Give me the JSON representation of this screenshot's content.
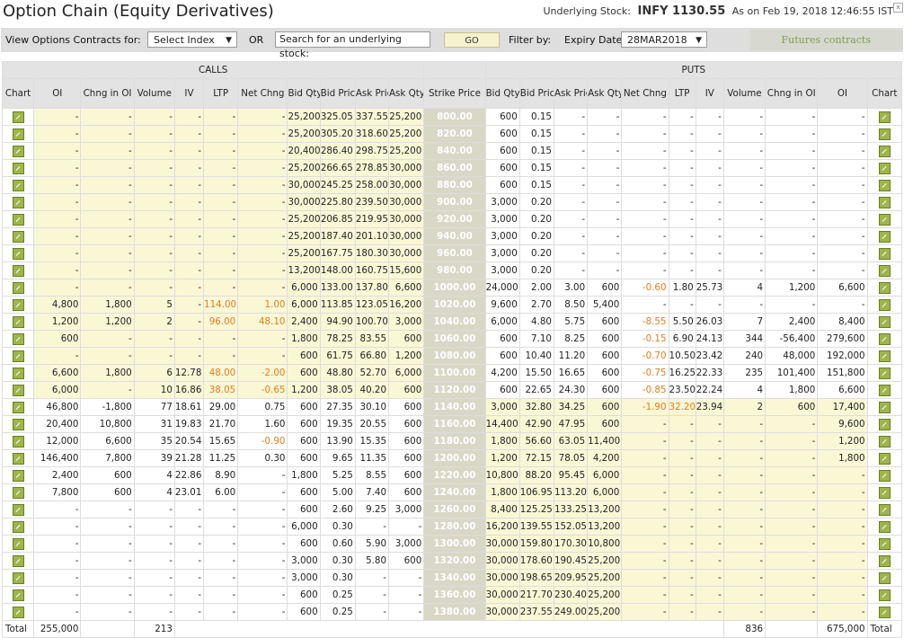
{
  "header": {
    "title": "Option Chain (Equity Derivatives)",
    "underlying_label": "Underlying Stock:",
    "underlying_value": "INFY 1130.55",
    "as_on": "As on Feb 19, 2018 12:46:55 IST",
    "close_glyph": "x"
  },
  "toolbar": {
    "view_label": "View Options Contracts for:",
    "index_select": "Select Index",
    "or_label": "OR",
    "search_value": "Search for an underlying stock:",
    "go_label": "GO",
    "filter_label": "Filter by:",
    "expiry_label": "Expiry Date",
    "expiry_value": "28MAR2018",
    "futures_link": "Futures contracts"
  },
  "table": {
    "calls_label": "CALLS",
    "puts_label": "PUTS",
    "headers": [
      "Chart",
      "OI",
      "Chng in OI",
      "Volume",
      "IV",
      "LTP",
      "Net Chng",
      "Bid Qty",
      "Bid Price",
      "Ask Price",
      "Ask Qty",
      "Strike Price",
      "Bid Qty",
      "Bid Price",
      "Ask Price",
      "Ask Qty",
      "Net Chng",
      "LTP",
      "IV",
      "Volume",
      "Chng in OI",
      "OI",
      "Chart"
    ],
    "rows": [
      [
        "",
        "-",
        "-",
        "-",
        "-",
        "-",
        "-",
        "25,200",
        "325.05",
        "337.55",
        "25,200",
        "800.00",
        "600",
        "0.15",
        "-",
        "-",
        "-",
        "-",
        "-",
        "-",
        "-",
        "-",
        ""
      ],
      [
        "",
        "-",
        "-",
        "-",
        "-",
        "-",
        "-",
        "25,200",
        "305.20",
        "318.60",
        "25,200",
        "820.00",
        "600",
        "0.15",
        "-",
        "-",
        "-",
        "-",
        "-",
        "-",
        "-",
        "-",
        ""
      ],
      [
        "",
        "-",
        "-",
        "-",
        "-",
        "-",
        "-",
        "20,400",
        "286.40",
        "298.75",
        "25,200",
        "840.00",
        "600",
        "0.15",
        "-",
        "-",
        "-",
        "-",
        "-",
        "-",
        "-",
        "-",
        ""
      ],
      [
        "",
        "-",
        "-",
        "-",
        "-",
        "-",
        "-",
        "25,200",
        "266.65",
        "278.85",
        "30,000",
        "860.00",
        "600",
        "0.15",
        "-",
        "-",
        "-",
        "-",
        "-",
        "-",
        "-",
        "-",
        ""
      ],
      [
        "",
        "-",
        "-",
        "-",
        "-",
        "-",
        "-",
        "30,000",
        "245.25",
        "258.00",
        "30,000",
        "880.00",
        "600",
        "0.15",
        "-",
        "-",
        "-",
        "-",
        "-",
        "-",
        "-",
        "-",
        ""
      ],
      [
        "",
        "-",
        "-",
        "-",
        "-",
        "-",
        "-",
        "30,000",
        "225.80",
        "239.50",
        "30,000",
        "900.00",
        "3,000",
        "0.20",
        "-",
        "-",
        "-",
        "-",
        "-",
        "-",
        "-",
        "-",
        ""
      ],
      [
        "",
        "-",
        "-",
        "-",
        "-",
        "-",
        "-",
        "25,200",
        "206.85",
        "219.95",
        "30,000",
        "920.00",
        "3,000",
        "0.20",
        "-",
        "-",
        "-",
        "-",
        "-",
        "-",
        "-",
        "-",
        ""
      ],
      [
        "",
        "-",
        "-",
        "-",
        "-",
        "-",
        "-",
        "25,200",
        "187.40",
        "201.10",
        "30,000",
        "940.00",
        "3,000",
        "0.20",
        "-",
        "-",
        "-",
        "-",
        "-",
        "-",
        "-",
        "-",
        ""
      ],
      [
        "",
        "-",
        "-",
        "-",
        "-",
        "-",
        "-",
        "25,200",
        "167.75",
        "180.30",
        "30,000",
        "960.00",
        "3,000",
        "0.20",
        "-",
        "-",
        "-",
        "-",
        "-",
        "-",
        "-",
        "-",
        ""
      ],
      [
        "",
        "-",
        "-",
        "-",
        "-",
        "-",
        "-",
        "13,200",
        "148.00",
        "160.75",
        "15,600",
        "980.00",
        "3,000",
        "0.20",
        "-",
        "-",
        "-",
        "-",
        "-",
        "-",
        "-",
        "-",
        ""
      ],
      [
        "",
        "-",
        "-",
        "-",
        "-",
        "-",
        "-",
        "6,000",
        "133.00",
        "137.80",
        "6,600",
        "1000.00",
        "24,000",
        "2.00",
        "3.00",
        "600",
        "-0.60",
        "1.80",
        "25.73",
        "4",
        "1,200",
        "6,600",
        ""
      ],
      [
        "",
        "4,800",
        "1,800",
        "5",
        "-",
        "114.00",
        "1.00",
        "6,000",
        "113.85",
        "123.05",
        "16,200",
        "1020.00",
        "9,600",
        "2.70",
        "8.50",
        "5,400",
        "-",
        "-",
        "-",
        "-",
        "-",
        "-",
        ""
      ],
      [
        "",
        "1,200",
        "1,200",
        "2",
        "-",
        "96.00",
        "48.10",
        "2,400",
        "94.90",
        "100.70",
        "3,000",
        "1040.00",
        "6,000",
        "4.80",
        "5.75",
        "600",
        "-8.55",
        "5.50",
        "26.03",
        "7",
        "2,400",
        "8,400",
        ""
      ],
      [
        "",
        "600",
        "-",
        "-",
        "-",
        "-",
        "-",
        "1,800",
        "78.25",
        "83.55",
        "600",
        "1060.00",
        "600",
        "7.10",
        "8.25",
        "600",
        "-0.15",
        "6.90",
        "24.13",
        "344",
        "-56,400",
        "279,600",
        ""
      ],
      [
        "",
        "-",
        "-",
        "-",
        "-",
        "-",
        "-",
        "600",
        "61.75",
        "66.80",
        "1,200",
        "1080.00",
        "600",
        "10.40",
        "11.20",
        "600",
        "-0.70",
        "10.50",
        "23.42",
        "240",
        "48,000",
        "192,000",
        ""
      ],
      [
        "",
        "6,600",
        "1,800",
        "6",
        "12.78",
        "48.00",
        "-2.00",
        "600",
        "48.80",
        "52.70",
        "6,000",
        "1100.00",
        "4,200",
        "15.50",
        "16.65",
        "600",
        "-0.75",
        "16.25",
        "22.33",
        "235",
        "101,400",
        "151,800",
        ""
      ],
      [
        "",
        "6,000",
        "-",
        "10",
        "16.86",
        "38.05",
        "-0.65",
        "1,200",
        "38.05",
        "40.20",
        "600",
        "1120.00",
        "600",
        "22.65",
        "24.30",
        "600",
        "-0.85",
        "23.50",
        "22.24",
        "4",
        "1,800",
        "6,600",
        ""
      ],
      [
        "",
        "46,800",
        "-1,800",
        "77",
        "18.61",
        "29.00",
        "0.75",
        "600",
        "27.35",
        "30.10",
        "600",
        "1140.00",
        "3,000",
        "32.80",
        "34.25",
        "600",
        "-1.90",
        "32.20",
        "23.94",
        "2",
        "600",
        "17,400",
        ""
      ],
      [
        "",
        "20,400",
        "10,800",
        "31",
        "19.83",
        "21.70",
        "1.60",
        "600",
        "19.35",
        "20.55",
        "600",
        "1160.00",
        "14,400",
        "42.90",
        "47.95",
        "600",
        "-",
        "-",
        "-",
        "-",
        "-",
        "9,600",
        ""
      ],
      [
        "",
        "12,000",
        "6,600",
        "35",
        "20.54",
        "15.65",
        "-0.90",
        "600",
        "13.90",
        "15.35",
        "600",
        "1180.00",
        "1,800",
        "56.60",
        "63.05",
        "11,400",
        "-",
        "-",
        "-",
        "-",
        "-",
        "1,200",
        ""
      ],
      [
        "",
        "146,400",
        "7,800",
        "39",
        "21.28",
        "11.25",
        "0.30",
        "600",
        "9.65",
        "11.35",
        "600",
        "1200.00",
        "1,200",
        "72.15",
        "78.05",
        "4,200",
        "-",
        "-",
        "-",
        "-",
        "-",
        "1,800",
        ""
      ],
      [
        "",
        "2,400",
        "600",
        "4",
        "22.86",
        "8.90",
        "-",
        "1,800",
        "5.25",
        "8.55",
        "600",
        "1220.00",
        "10,800",
        "88.20",
        "95.45",
        "6,000",
        "-",
        "-",
        "-",
        "-",
        "-",
        "-",
        ""
      ],
      [
        "",
        "7,800",
        "600",
        "4",
        "23.01",
        "6.00",
        "-",
        "600",
        "5.00",
        "7.40",
        "600",
        "1240.00",
        "1,800",
        "106.95",
        "113.20",
        "6,000",
        "-",
        "-",
        "-",
        "-",
        "-",
        "-",
        ""
      ],
      [
        "",
        "-",
        "-",
        "-",
        "-",
        "-",
        "-",
        "600",
        "2.60",
        "9.25",
        "3,000",
        "1260.00",
        "8,400",
        "125.25",
        "133.25",
        "13,200",
        "-",
        "-",
        "-",
        "-",
        "-",
        "-",
        ""
      ],
      [
        "",
        "-",
        "-",
        "-",
        "-",
        "-",
        "-",
        "6,000",
        "0.30",
        "-",
        "-",
        "1280.00",
        "16,200",
        "139.55",
        "152.05",
        "13,200",
        "-",
        "-",
        "-",
        "-",
        "-",
        "-",
        ""
      ],
      [
        "",
        "-",
        "-",
        "-",
        "-",
        "-",
        "-",
        "600",
        "0.60",
        "5.90",
        "3,000",
        "1300.00",
        "30,000",
        "159.80",
        "170.30",
        "10,800",
        "-",
        "-",
        "-",
        "-",
        "-",
        "-",
        ""
      ],
      [
        "",
        "-",
        "-",
        "-",
        "-",
        "-",
        "-",
        "3,000",
        "0.30",
        "5.80",
        "600",
        "1320.00",
        "30,000",
        "178.60",
        "190.45",
        "25,200",
        "-",
        "-",
        "-",
        "-",
        "-",
        "-",
        ""
      ],
      [
        "",
        "-",
        "-",
        "-",
        "-",
        "-",
        "-",
        "3,000",
        "0.30",
        "-",
        "-",
        "1340.00",
        "30,000",
        "198.65",
        "209.95",
        "25,200",
        "-",
        "-",
        "-",
        "-",
        "-",
        "-",
        ""
      ],
      [
        "",
        "-",
        "-",
        "-",
        "-",
        "-",
        "-",
        "600",
        "0.25",
        "-",
        "-",
        "1360.00",
        "30,000",
        "217.70",
        "230.40",
        "25,200",
        "-",
        "-",
        "-",
        "-",
        "-",
        "-",
        ""
      ],
      [
        "",
        "-",
        "-",
        "-",
        "-",
        "-",
        "-",
        "600",
        "0.25",
        "-",
        "-",
        "1380.00",
        "30,000",
        "237.55",
        "249.00",
        "25,200",
        "-",
        "-",
        "-",
        "-",
        "-",
        "-",
        ""
      ]
    ],
    "totals": {
      "label_left": "Total",
      "calls_oi": "255,000",
      "calls_volume": "213",
      "puts_volume": "836",
      "puts_oi": "675,000",
      "label_right": "Total"
    }
  }
}
